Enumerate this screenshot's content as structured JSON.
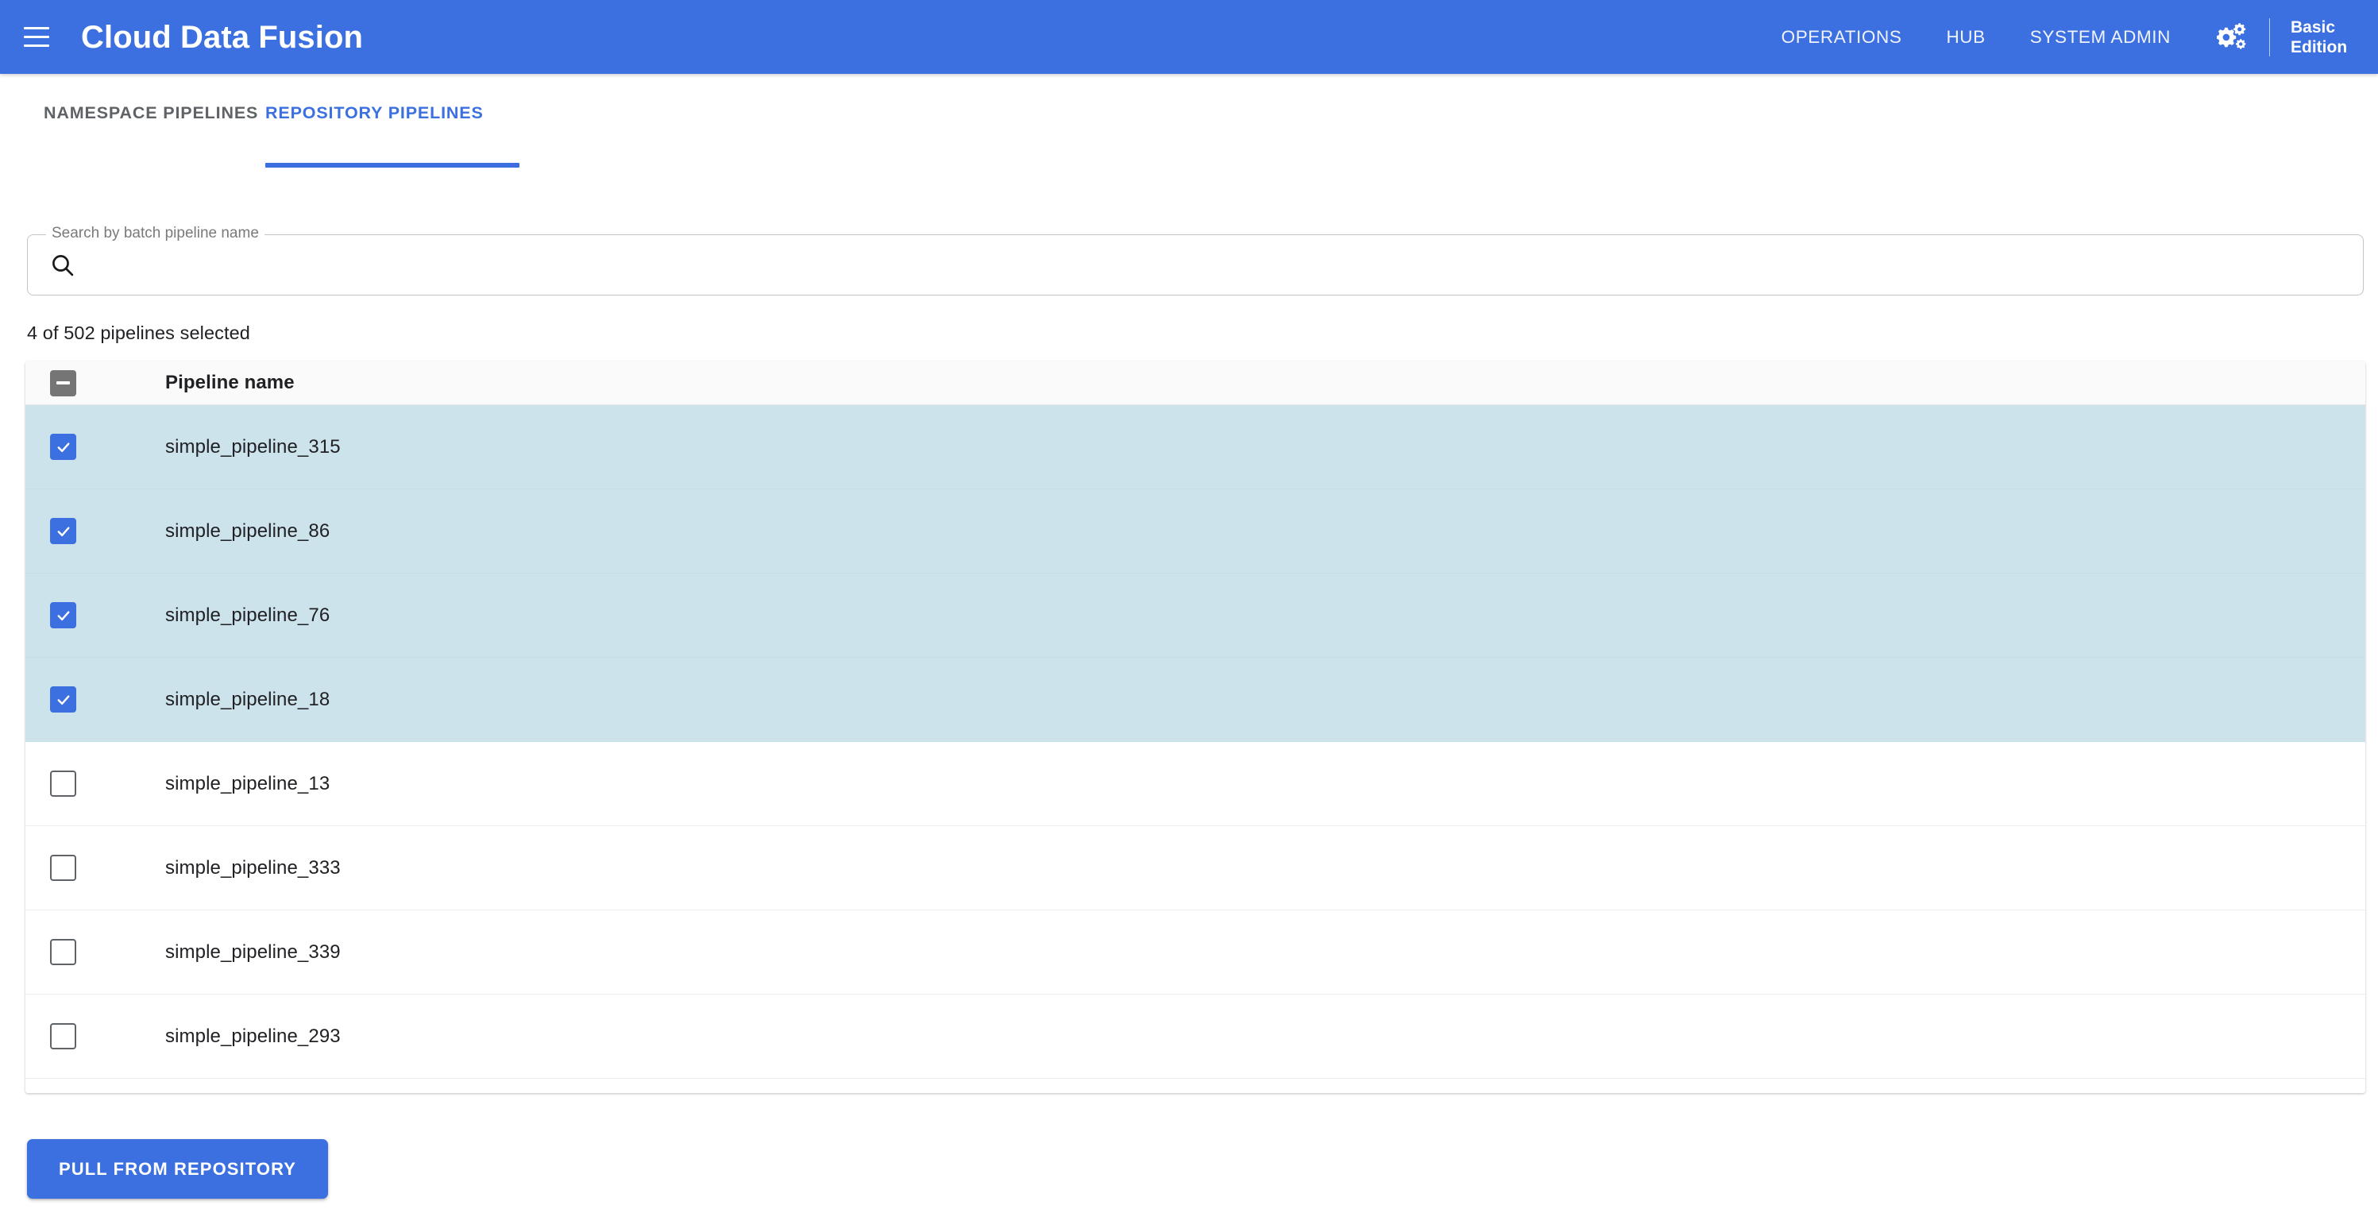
{
  "appbar": {
    "menu_icon": "hamburger-menu-icon",
    "brand": "Cloud Data Fusion",
    "nav": [
      {
        "label": "OPERATIONS",
        "name": "operations"
      },
      {
        "label": "HUB",
        "name": "hub"
      },
      {
        "label": "SYSTEM ADMIN",
        "name": "system-admin"
      }
    ],
    "settings_icon": "gears-icon",
    "edition": "Basic Edition",
    "background_color": "#3c70e0"
  },
  "tabs": [
    {
      "label": "NAMESPACE PIPELINES",
      "active": false
    },
    {
      "label": "REPOSITORY PIPELINES",
      "active": true
    }
  ],
  "search": {
    "legend": "Search by batch pipeline name",
    "value": "",
    "placeholder": "",
    "icon": "search-icon"
  },
  "selection": {
    "count_text": "4 of 502 pipelines selected",
    "selected": 4,
    "total": 502
  },
  "table": {
    "header_checkbox_state": "indeterminate",
    "columns": [
      "Pipeline name"
    ],
    "rows": [
      {
        "name": "simple_pipeline_315",
        "checked": true
      },
      {
        "name": "simple_pipeline_86",
        "checked": true
      },
      {
        "name": "simple_pipeline_76",
        "checked": true
      },
      {
        "name": "simple_pipeline_18",
        "checked": true
      },
      {
        "name": "simple_pipeline_13",
        "checked": false
      },
      {
        "name": "simple_pipeline_333",
        "checked": false
      },
      {
        "name": "simple_pipeline_339",
        "checked": false
      },
      {
        "name": "simple_pipeline_293",
        "checked": false
      }
    ]
  },
  "footer": {
    "pull_label": "PULL FROM REPOSITORY"
  },
  "colors": {
    "accent": "#3c70e0",
    "selected_row": "#cde3ec",
    "header_row": "#fafafa",
    "text": "#202124",
    "muted_text": "#5f6368"
  }
}
